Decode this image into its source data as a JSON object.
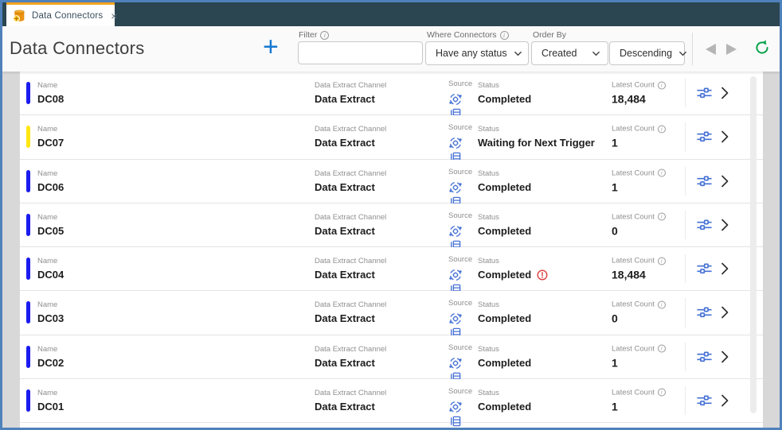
{
  "colors": {
    "accent_blue": "#1778d2",
    "topbar_teal": "#2b4650",
    "tab_accent_orange": "#f2a31d",
    "frame_border_blue": "#4f81bb",
    "row_bar_blue": "#1b1bf0",
    "row_bar_yellow": "#ffe712",
    "icon_blue": "#4470d4",
    "refresh_green": "#0ba34d",
    "warning_red": "#dd4040"
  },
  "tab": {
    "title": "Data Connectors",
    "close_glyph": "×"
  },
  "header": {
    "title": "Data Connectors",
    "add_glyph": "+",
    "filter": {
      "label": "Filter",
      "value": "",
      "placeholder": ""
    },
    "where_connectors": {
      "label": "Where Connectors",
      "value": "Have any status"
    },
    "order_by": {
      "label": "Order By",
      "field_value": "Created",
      "direction_value": "Descending"
    }
  },
  "list": {
    "field_labels": {
      "name": "Name",
      "channel": "Data Extract Channel",
      "source": "Source",
      "status": "Status",
      "latest_count": "Latest Count"
    },
    "rows": [
      {
        "name": "DC08",
        "channel": "Data Extract",
        "source_icon": "connection-gear-icon",
        "status": "Completed",
        "warning": false,
        "latest_count": "18,484",
        "bar_color": "#1b1bf0"
      },
      {
        "name": "DC07",
        "channel": "Data Extract",
        "source_icon": "database-table-icon",
        "status": "Waiting for Next Trigger",
        "warning": false,
        "latest_count": "1",
        "bar_color": "#ffe712"
      },
      {
        "name": "DC06",
        "channel": "Data Extract",
        "source_icon": "database-table-icon",
        "status": "Completed",
        "warning": false,
        "latest_count": "1",
        "bar_color": "#1b1bf0"
      },
      {
        "name": "DC05",
        "channel": "Data Extract",
        "source_icon": "connection-gear-icon",
        "status": "Completed",
        "warning": false,
        "latest_count": "0",
        "bar_color": "#1b1bf0"
      },
      {
        "name": "DC04",
        "channel": "Data Extract",
        "source_icon": "connection-gear-icon",
        "status": "Completed",
        "warning": true,
        "latest_count": "18,484",
        "bar_color": "#1b1bf0"
      },
      {
        "name": "DC03",
        "channel": "Data Extract",
        "source_icon": "database-table-icon",
        "status": "Completed",
        "warning": false,
        "latest_count": "0",
        "bar_color": "#1b1bf0"
      },
      {
        "name": "DC02",
        "channel": "Data Extract",
        "source_icon": "database-table-icon",
        "status": "Completed",
        "warning": false,
        "latest_count": "1",
        "bar_color": "#1b1bf0"
      },
      {
        "name": "DC01",
        "channel": "Data Extract",
        "source_icon": "database-table-icon",
        "status": "Completed",
        "warning": false,
        "latest_count": "1",
        "bar_color": "#1b1bf0"
      }
    ]
  }
}
